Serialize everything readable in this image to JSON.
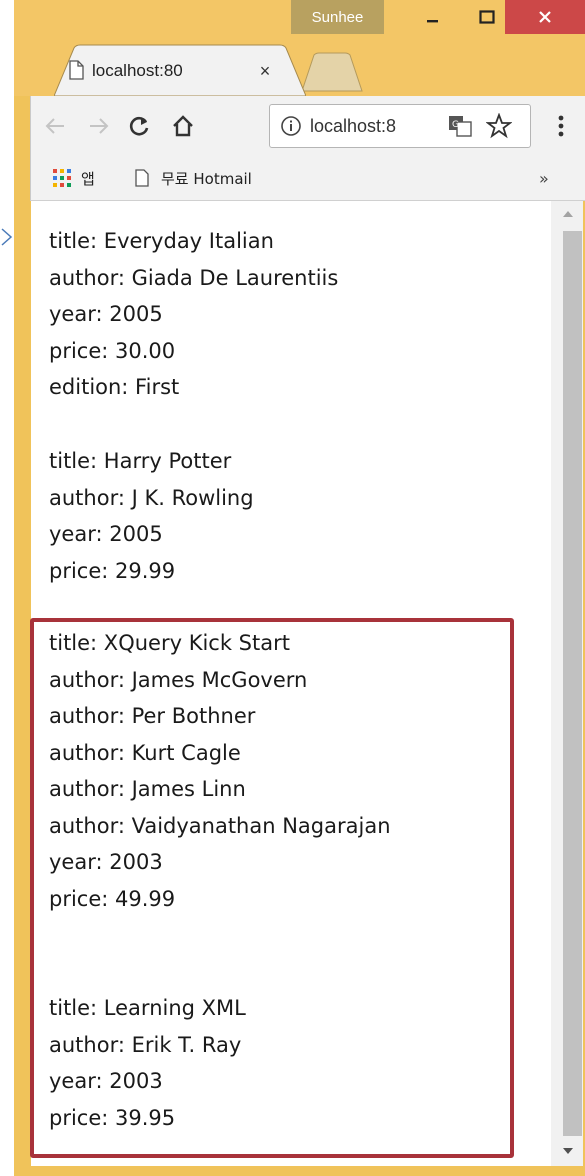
{
  "window": {
    "user": "Sunhee",
    "tab_title": "localhost:80",
    "tab_close": "×"
  },
  "toolbar": {
    "back_icon": "arrow-left-icon",
    "forward_icon": "arrow-right-icon",
    "reload_icon": "reload-icon",
    "home_icon": "home-icon",
    "address": "localhost:8",
    "star_icon": "star-icon",
    "menu_icon": "vertical-dots-icon"
  },
  "bookmarks": {
    "apps_label": "앱",
    "hotmail_label": "무료 Hotmail",
    "overflow": "»"
  },
  "books": [
    {
      "lines": [
        "title: Everyday Italian",
        "author: Giada De Laurentiis",
        "year: 2005",
        "price: 30.00",
        "edition: First"
      ]
    },
    {
      "lines": [
        "title: Harry Potter",
        "author: J K. Rowling",
        "year: 2005",
        "price: 29.99"
      ]
    },
    {
      "lines": [
        "title: XQuery Kick Start",
        "author: James McGovern",
        "author: Per Bothner",
        "author: Kurt Cagle",
        "author: James Linn",
        "author: Vaidyanathan Nagarajan",
        "year: 2003",
        "price: 49.99"
      ]
    },
    {
      "lines": [
        "title: Learning XML",
        "author: Erik T. Ray",
        "year: 2003",
        "price: 39.95"
      ]
    }
  ],
  "colors": {
    "frame": "#f3c666",
    "close_button": "#cc4848",
    "highlight": "#a8323a"
  }
}
